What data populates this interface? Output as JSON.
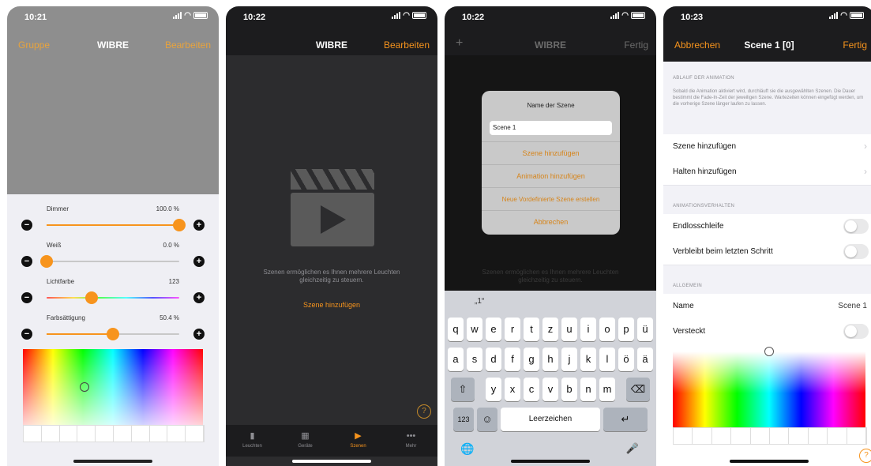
{
  "screen1": {
    "time": "10:21",
    "nav": {
      "left": "Gruppe",
      "title": "WIBRE",
      "right": "Bearbeiten"
    },
    "sliders": [
      {
        "label": "Dimmer",
        "value": "100.0 %",
        "level": 1.0,
        "minus": "−",
        "plus": "+"
      },
      {
        "label": "Weiß",
        "value": "0.0 %",
        "level": 0.0,
        "minus": "−",
        "plus": "+"
      },
      {
        "label": "Lichtfarbe",
        "value": "123",
        "level": 0.34,
        "minus": "−",
        "plus": "+"
      },
      {
        "label": "Farbsättigung",
        "value": "50.4 %",
        "level": 0.5,
        "minus": "−",
        "plus": "+"
      }
    ]
  },
  "screen2": {
    "time": "10:22",
    "nav": {
      "title": "WIBRE",
      "right": "Bearbeiten"
    },
    "empty_text": "Szenen ermöglichen es Ihnen mehrere Leuchten gleichzeitig zu steuern.",
    "add_link": "Szene hinzufügen",
    "help": "?",
    "tabs": [
      {
        "label": "Leuchten",
        "icon": "bulb-icon",
        "glyph": "▮",
        "active": false
      },
      {
        "label": "Geräte",
        "icon": "device-icon",
        "glyph": "▦",
        "active": false
      },
      {
        "label": "Szenen",
        "icon": "scene-icon",
        "glyph": "▶",
        "active": true
      },
      {
        "label": "Mehr",
        "icon": "more-icon",
        "glyph": "•••",
        "active": false
      }
    ]
  },
  "screen3": {
    "time": "10:22",
    "nav": {
      "left": "+",
      "title": "WIBRE",
      "right": "Fertig"
    },
    "alert": {
      "title": "Name der Szene",
      "input_value": "Scene 1",
      "buttons": [
        "Szene hinzufügen",
        "Animation hinzufügen",
        "Neue Vordefinierte Szene erstellen",
        "Abbrechen"
      ]
    },
    "background_text": "Szenen ermöglichen es Ihnen mehrere Leuchten gleichzeitig zu steuern.",
    "keyboard": {
      "suggestion": "„1“",
      "row1": [
        "q",
        "w",
        "e",
        "r",
        "t",
        "z",
        "u",
        "i",
        "o",
        "p",
        "ü"
      ],
      "row2": [
        "a",
        "s",
        "d",
        "f",
        "g",
        "h",
        "j",
        "k",
        "l",
        "ö",
        "ä"
      ],
      "row3": [
        "y",
        "x",
        "c",
        "v",
        "b",
        "n",
        "m"
      ],
      "shift": "⇧",
      "delete": "⌫",
      "numbers": "123",
      "emoji": "☺",
      "space": "Leerzeichen",
      "return": "↵",
      "globe": "🌐",
      "mic": "🎤"
    }
  },
  "screen4": {
    "time": "10:23",
    "nav": {
      "left": "Abbrechen",
      "title": "Scene 1 [0]",
      "right": "Fertig"
    },
    "section_animation": "ABLAUF DER ANIMATION",
    "animation_desc": "Sobald die Animation aktiviert wird, durchläuft sie die ausgewählten Szenen. Die Dauer bestimmt die Fade-In-Zeit der jeweiligen Szene. Wartezeiten können eingefügt werden, um die vorherige Szene länger laufen zu lassen.",
    "rows_animation": [
      {
        "label": "Szene hinzufügen",
        "chevron": "›"
      },
      {
        "label": "Halten hinzufügen",
        "chevron": "›"
      }
    ],
    "section_behavior": "ANIMATIONSVERHALTEN",
    "rows_behavior": [
      {
        "label": "Endlosschleife",
        "on": false
      },
      {
        "label": "Verbleibt beim letzten Schritt",
        "on": false
      }
    ],
    "section_general": "ALLGEMEIN",
    "name_label": "Name",
    "name_value": "Scene 1",
    "hidden_label": "Versteckt",
    "help": "?"
  }
}
